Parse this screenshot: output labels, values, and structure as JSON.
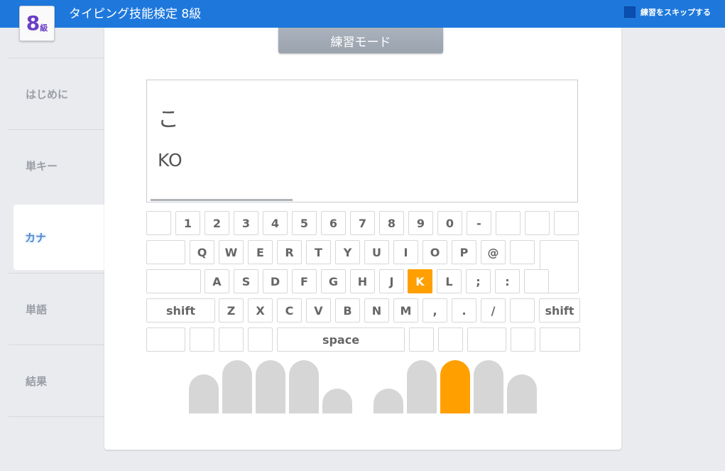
{
  "header": {
    "title": "タイピング技能検定 8級",
    "level_number": "8",
    "level_unit": "級",
    "skip_label": "練習をスキップする"
  },
  "sidebar": {
    "items": [
      {
        "label": "はじめに",
        "active": false
      },
      {
        "label": "単キー",
        "active": false
      },
      {
        "label": "カナ",
        "active": true
      },
      {
        "label": "単語",
        "active": false
      },
      {
        "label": "結果",
        "active": false
      }
    ]
  },
  "mode": {
    "label": "練習モード"
  },
  "prompt": {
    "kana": "こ",
    "romaji": "KO"
  },
  "progress_fraction": 0.33,
  "keyboard": {
    "row1": [
      "",
      "1",
      "2",
      "3",
      "4",
      "5",
      "6",
      "7",
      "8",
      "9",
      "0",
      "-",
      "",
      "",
      ""
    ],
    "row2": [
      "",
      "Q",
      "W",
      "E",
      "R",
      "T",
      "Y",
      "U",
      "I",
      "O",
      "P",
      "@",
      "",
      ""
    ],
    "row3": [
      "",
      "A",
      "S",
      "D",
      "F",
      "G",
      "H",
      "J",
      "K",
      "L",
      ";",
      ":",
      ""
    ],
    "row4": [
      "shift",
      "Z",
      "X",
      "C",
      "V",
      "B",
      "N",
      "M",
      ",",
      ".",
      "/",
      "",
      "shift"
    ],
    "row5": [
      "",
      "",
      "",
      "",
      "space",
      "",
      "",
      "",
      "",
      ""
    ],
    "active_key": "K"
  },
  "fingers": {
    "active_index": 7
  },
  "colors": {
    "header": "#1e78dc",
    "accent": "#ff9f00",
    "level": "#6b3fc6"
  }
}
